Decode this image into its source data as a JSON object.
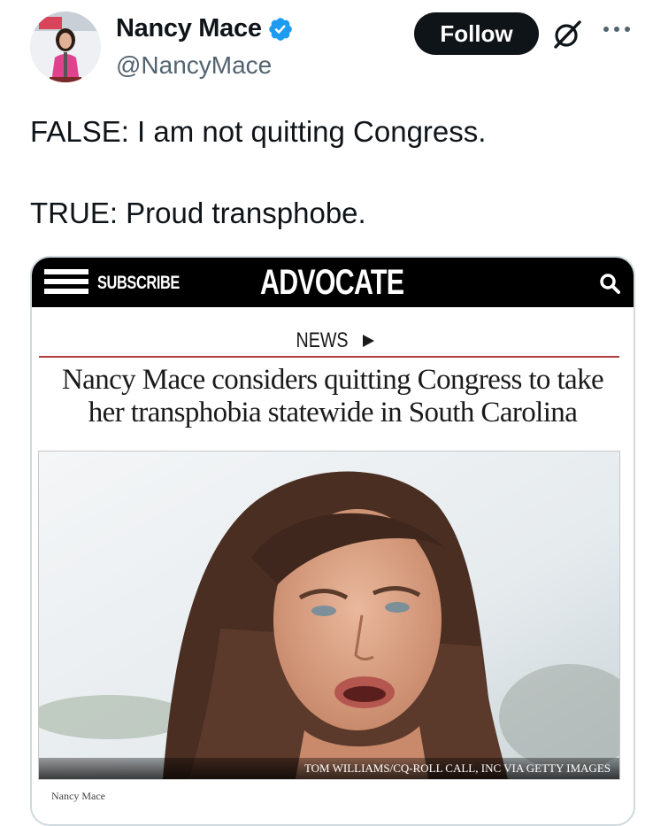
{
  "author": {
    "name": "Nancy Mace",
    "handle": "@NancyMace",
    "verified_color": "#1d9bf0"
  },
  "actions": {
    "follow_label": "Follow",
    "grok_icon": "grok-icon",
    "more_icon": "more-icon"
  },
  "tweet": {
    "line1": "FALSE: I am not quitting Congress.",
    "line2": "TRUE: Proud transphobe."
  },
  "article": {
    "subscribe_label": "SUBSCRIBE",
    "logo": "ADVOCATE",
    "section": "NEWS",
    "headline_line1": "Nancy Mace considers quitting Congress to take",
    "headline_line2": "her transphobia statewide in South Carolina",
    "photo_credit": "TOM WILLIAMS/CQ-ROLL CALL, INC VIA GETTY IMAGES",
    "caption": "Nancy Mace",
    "rule_color": "#b23a3a"
  }
}
